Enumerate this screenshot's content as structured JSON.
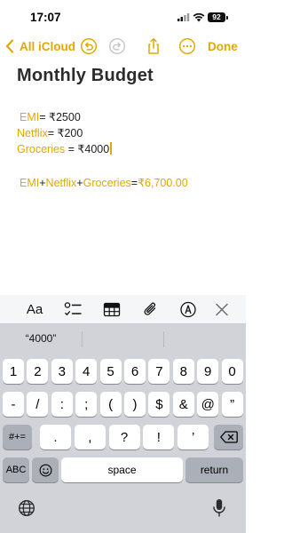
{
  "status_bar": {
    "time": "17:07",
    "battery": "92"
  },
  "nav": {
    "back_label": "All iCloud",
    "done_label": "Done"
  },
  "note": {
    "title": "Monthly Budget",
    "lines": [
      {
        "label": "EMI",
        "value": "= ₹2500"
      },
      {
        "label": "Netflix",
        "value": "= ₹200"
      },
      {
        "label": "Groceries",
        "value": " = ₹4000"
      }
    ],
    "formula": {
      "part1": "EMI",
      "plus1": "+",
      "part2": "Netflix",
      "plus2": "+",
      "part3": "Groceries",
      "eq": "=",
      "result": "₹6,700.00"
    }
  },
  "toolbar": {
    "format_label": "Aa"
  },
  "suggestion": "“4000”",
  "keyboard": {
    "row1": [
      "1",
      "2",
      "3",
      "4",
      "5",
      "6",
      "7",
      "8",
      "9",
      "0"
    ],
    "row2": [
      "-",
      "/",
      ":",
      ";",
      "(",
      ")",
      "$",
      "&",
      "@",
      "”"
    ],
    "row3": [
      ".",
      ",",
      "?",
      "!",
      "’"
    ],
    "symbols_key": "#+=",
    "abc_key": "ABC",
    "space_key": "space",
    "return_key": "return"
  },
  "colors": {
    "accent": "#e1a800",
    "keyboard_bg": "#d1d3d9"
  }
}
